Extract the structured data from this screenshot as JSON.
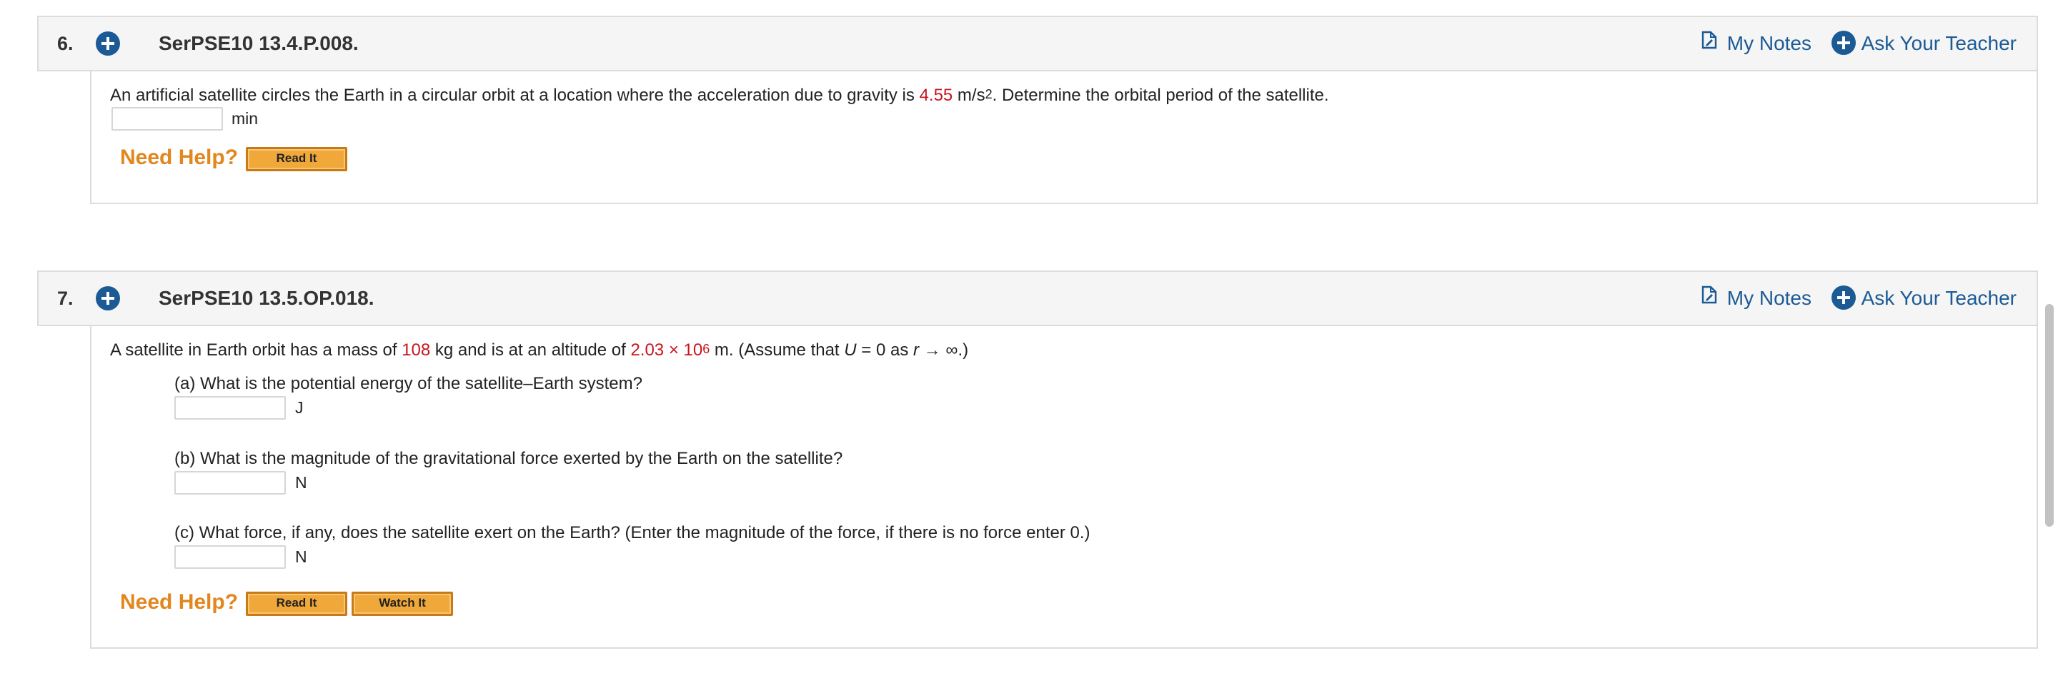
{
  "questions": [
    {
      "number": "6.",
      "id": "SerPSE10 13.4.P.008.",
      "my_notes": "My Notes",
      "ask_teacher": "Ask Your Teacher",
      "stem": {
        "t1": "An artificial satellite circles the Earth in a circular orbit at a location where the acceleration due to gravity is ",
        "value": "4.55",
        "t2": " m/s",
        "exp": "2",
        "t3": ". Determine the orbital period of the satellite."
      },
      "answers": [
        {
          "value": "",
          "unit": "min"
        }
      ],
      "need_help": "Need Help?",
      "help_buttons": [
        "Read It"
      ]
    },
    {
      "number": "7.",
      "id": "SerPSE10 13.5.OP.018.",
      "my_notes": "My Notes",
      "ask_teacher": "Ask Your Teacher",
      "stem": {
        "t1": "A satellite in Earth orbit has a mass of ",
        "mass": "108",
        "t2": " kg and is at an altitude of ",
        "altitude": "2.03 × 10",
        "altitude_exp": "6",
        "t3": " m. (Assume that ",
        "u": "U",
        "t4": " = 0 as ",
        "r": "r",
        "t5": " → ∞.)"
      },
      "parts": [
        {
          "text": "(a) What is the potential energy of the satellite–Earth system?",
          "value": "",
          "unit": "J"
        },
        {
          "text": "(b) What is the magnitude of the gravitational force exerted by the Earth on the satellite?",
          "value": "",
          "unit": "N"
        },
        {
          "text": "(c) What force, if any, does the satellite exert on the Earth? (Enter the magnitude of the force, if there is no force enter 0.)",
          "value": "",
          "unit": "N"
        }
      ],
      "need_help": "Need Help?",
      "help_buttons": [
        "Read It",
        "Watch It"
      ]
    }
  ],
  "icons": {
    "expand": "plus-circle-icon",
    "notes": "document-edit-icon",
    "ask": "plus-circle-icon"
  },
  "colors": {
    "link_blue": "#1b5a94",
    "value_red": "#c8161d",
    "need_help_orange": "#e2861e",
    "button_orange": "#f0a83a"
  }
}
